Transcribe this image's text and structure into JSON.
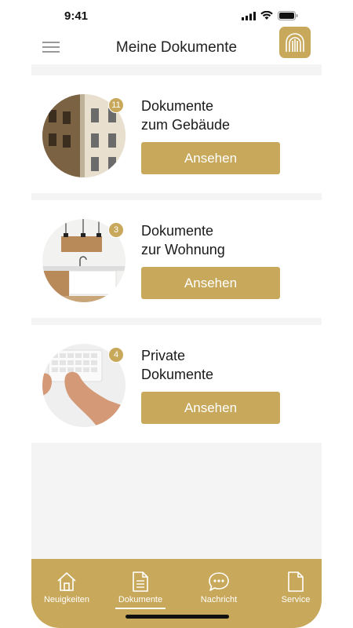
{
  "status_bar": {
    "time": "9:41"
  },
  "header": {
    "title": "Meine Dokumente"
  },
  "cards": [
    {
      "title": "Dokumente\nzum Gebäude",
      "badge": "11",
      "button_label": "Ansehen"
    },
    {
      "title": "Dokumente\nzur Wohnung",
      "badge": "3",
      "button_label": "Ansehen"
    },
    {
      "title": "Private\nDokumente",
      "badge": "4",
      "button_label": "Ansehen"
    }
  ],
  "bottom_nav": {
    "items": [
      {
        "label": "Neuigkeiten",
        "icon": "home-icon"
      },
      {
        "label": "Dokumente",
        "icon": "document-icon",
        "active": true
      },
      {
        "label": "Nachricht",
        "icon": "chat-icon"
      },
      {
        "label": "Service",
        "icon": "file-icon"
      }
    ]
  },
  "colors": {
    "accent": "#c8a85a",
    "background": "#f4f4f4"
  }
}
